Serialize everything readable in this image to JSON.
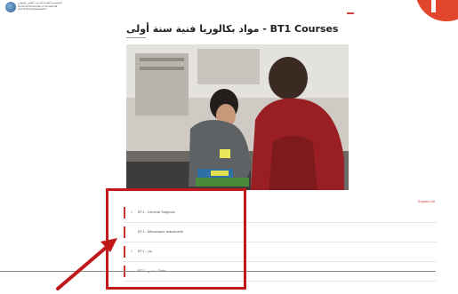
{
  "header": {
    "org_name_ar": "المؤسسة العامة للتدريب التقني والمهني",
    "org_name_en_1": "General Directorate of Vocational",
    "org_name_en_2": "and Technical Education",
    "logo_icon": "org-logo-icon",
    "accent_color": "#d23b3b"
  },
  "page": {
    "title": "مواد بكالوريا فنية سنة أولى - BT1 Courses"
  },
  "courses": {
    "expand_all": "Expand all",
    "items": [
      {
        "label": "BT1 - General Subjects",
        "has_chevron": true
      },
      {
        "label": "BT1 - Mécanique Industrielle",
        "has_chevron": false
      },
      {
        "label": "BT1 - بناء",
        "has_chevron": true
      },
      {
        "label": "BT1 - مدني - Solo",
        "has_chevron": false
      }
    ]
  },
  "annotation": {
    "highlight_color": "#c0191c",
    "arrow_icon": "pointer-arrow-icon"
  },
  "badge": {
    "color": "#e2462d"
  }
}
